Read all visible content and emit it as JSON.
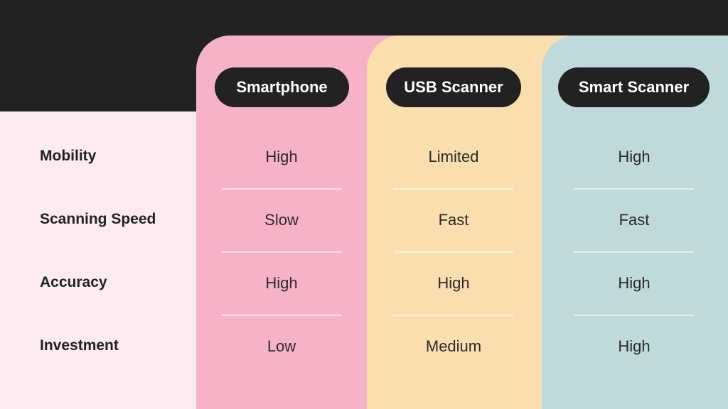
{
  "colors": {
    "background_dark": "#222222",
    "label_column": "#FCEBF0",
    "smartphone": "#F6B3C8",
    "usb_scanner": "#FADEAE",
    "smart_scanner": "#C0DADB"
  },
  "rows": [
    "Mobility",
    "Scanning Speed",
    "Accuracy",
    "Investment"
  ],
  "columns": [
    {
      "title": "Smartphone",
      "values": [
        "High",
        "Slow",
        "High",
        "Low"
      ]
    },
    {
      "title": "USB Scanner",
      "values": [
        "Limited",
        "Fast",
        "High",
        "Medium"
      ]
    },
    {
      "title": "Smart Scanner",
      "values": [
        "High",
        "Fast",
        "High",
        "High"
      ]
    }
  ]
}
